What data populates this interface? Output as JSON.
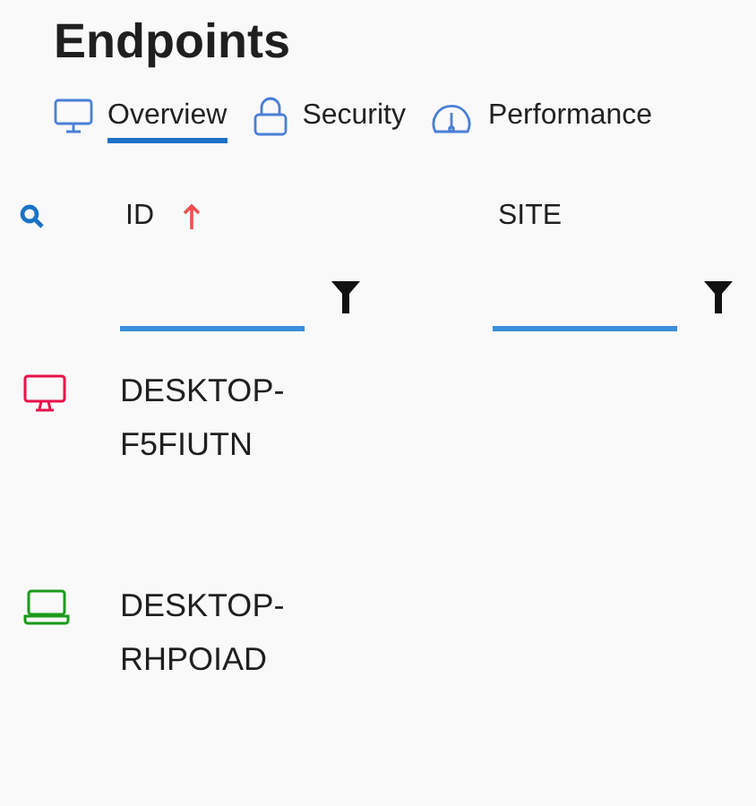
{
  "title": "Endpoints",
  "tabs": [
    {
      "label": "Overview",
      "kind": "monitor",
      "selected": true
    },
    {
      "label": "Security",
      "kind": "lock",
      "selected": false
    },
    {
      "label": "Performance",
      "kind": "gauge",
      "selected": false
    }
  ],
  "table": {
    "columns": [
      {
        "label": "ID",
        "sorted": true
      },
      {
        "label": "SITE",
        "sorted": false
      }
    ],
    "rows": [
      {
        "kind": "desktop",
        "color": "#e8114a",
        "id": "DESKTOP-F5FIUTN"
      },
      {
        "kind": "laptop",
        "color": "#1a9a1a",
        "id": "DESKTOP-RHPOIAD"
      }
    ]
  }
}
